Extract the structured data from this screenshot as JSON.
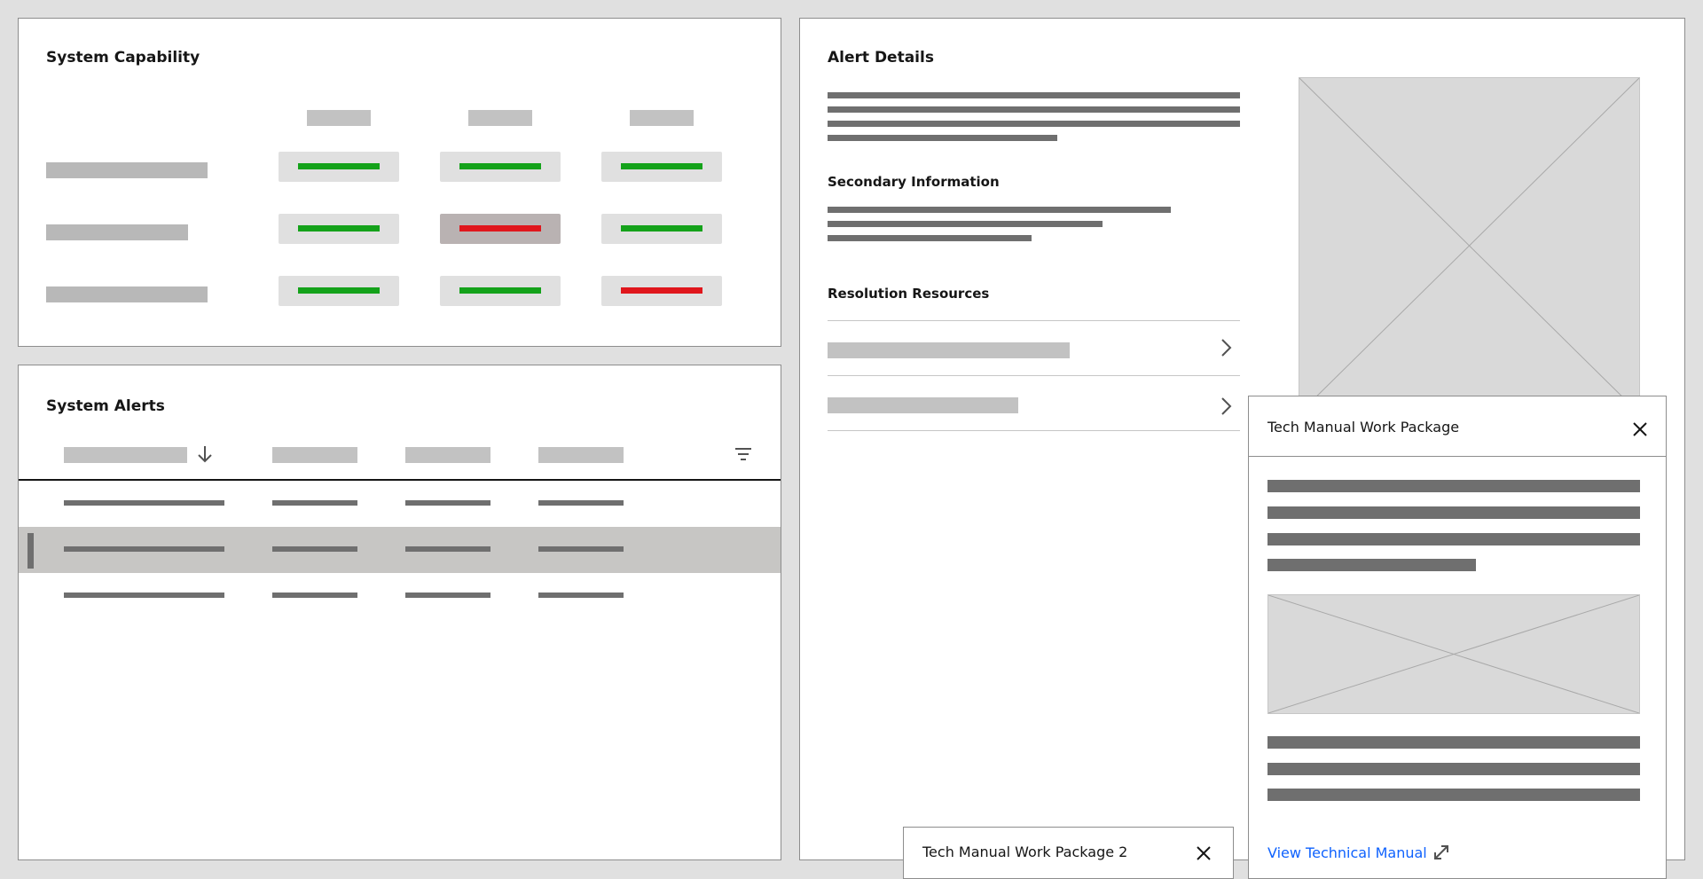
{
  "capability": {
    "title": "System Capability",
    "rows": [
      [
        "ok",
        "ok",
        "ok"
      ],
      [
        "ok",
        "fail",
        "ok"
      ],
      [
        "ok",
        "ok",
        "fail"
      ]
    ],
    "selected_cell": [
      1,
      1
    ]
  },
  "alerts": {
    "title": "System Alerts",
    "sort_icon": "arrow-down-icon",
    "filter_icon": "filter-icon",
    "selected_row": 1
  },
  "details": {
    "title": "Alert Details",
    "secondary_heading": "Secondary Information",
    "resources_heading": "Resolution Resources"
  },
  "popover": {
    "title": "Tech Manual Work Package",
    "link_label": "View Technical Manual",
    "link_icon": "expand-icon",
    "close_icon": "close-icon"
  },
  "toast": {
    "title": "Tech Manual Work Package 2",
    "close_icon": "close-icon"
  },
  "colors": {
    "status_ok": "#14a21a",
    "status_fail": "#e0161c",
    "link": "#0f62fe",
    "background": "#e0e0e0"
  }
}
